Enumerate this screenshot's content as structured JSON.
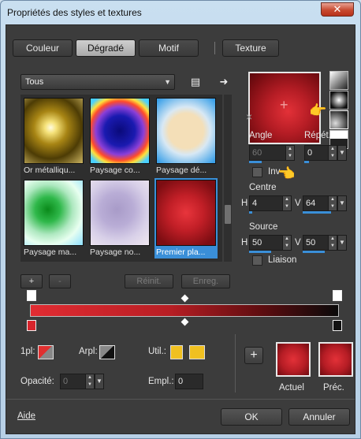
{
  "window": {
    "title": "Propriétés des styles et textures",
    "close_label": "✕"
  },
  "tabs": [
    {
      "label": "Couleur"
    },
    {
      "label": "Dégradé"
    },
    {
      "label": "Motif"
    },
    {
      "label": "Texture"
    }
  ],
  "active_tab": "Dégradé",
  "category": {
    "value": "Tous"
  },
  "gradients": [
    {
      "caption": "Or métalliqu..."
    },
    {
      "caption": "Paysage co..."
    },
    {
      "caption": "Paysage dé..."
    },
    {
      "caption": "Paysage ma..."
    },
    {
      "caption": "Paysage no..."
    },
    {
      "caption": "Premier pla..."
    }
  ],
  "list_buttons": {
    "add": "+",
    "remove": "-",
    "reset": "Réinit.",
    "save": "Enreg."
  },
  "angle": {
    "label": "Angle",
    "value": "60"
  },
  "repeat": {
    "label": "Répét.",
    "value": "0"
  },
  "invert": {
    "label": "Inv"
  },
  "center": {
    "label": "Centre",
    "h_label": "H",
    "h_value": "4",
    "v_label": "V",
    "v_value": "64"
  },
  "source": {
    "label": "Source",
    "h_label": "H",
    "h_value": "50",
    "v_label": "V",
    "v_value": "50"
  },
  "link": {
    "label": "Liaison"
  },
  "stops": {
    "first_label": "1pl:",
    "back_label": "Arpl:",
    "user_label": "Util.:",
    "opacity_label": "Opacité:",
    "opacity_value": "0",
    "location_label": "Empl.:",
    "location_value": "0"
  },
  "current_label": "Actuel",
  "previous_label": "Préc.",
  "help_label": "Aide",
  "ok_label": "OK",
  "cancel_label": "Annuler",
  "colors": {
    "accent": "#3a8fd8",
    "red": "#e12c32",
    "user_yellow": "#f0c020"
  }
}
